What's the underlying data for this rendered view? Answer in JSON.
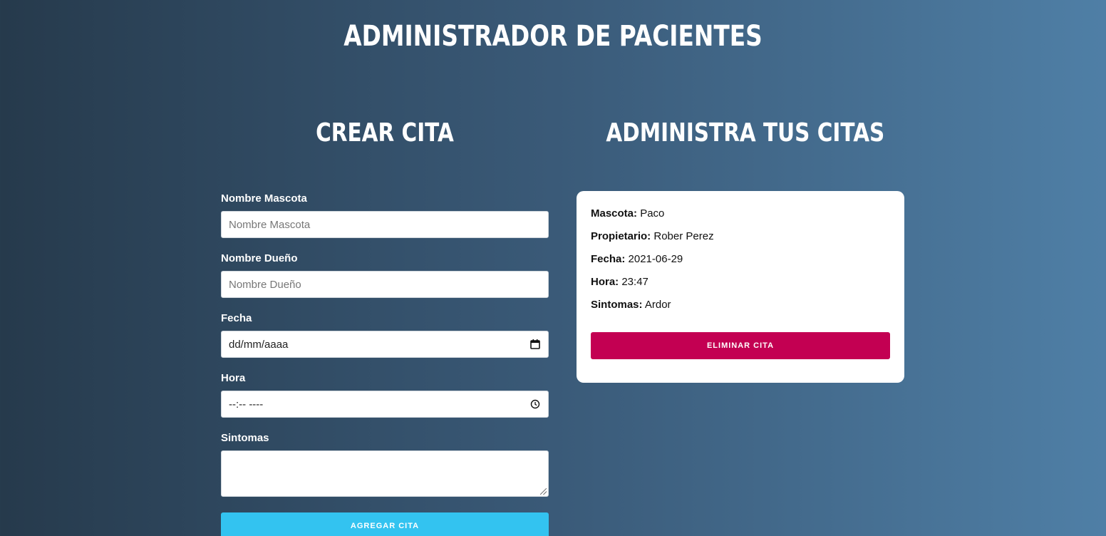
{
  "header": {
    "title": "ADMINISTRADOR DE PACIENTES"
  },
  "form": {
    "title": "CREAR CITA",
    "fields": [
      {
        "label": "Nombre Mascota",
        "placeholder": "Nombre Mascota"
      },
      {
        "label": "Nombre Dueño",
        "placeholder": "Nombre Dueño"
      },
      {
        "label": "Fecha",
        "value": "dd/mm/aaaa",
        "icon": "calendar-icon"
      },
      {
        "label": "Hora",
        "value": "--:-- ----",
        "icon": "clock-icon"
      },
      {
        "label": "Sintomas",
        "value": ""
      }
    ],
    "submit_label": "AGREGAR CITA"
  },
  "appointments": {
    "title": "ADMINISTRA TUS CITAS",
    "items": [
      {
        "pet_label": "Mascota:",
        "pet": "Paco",
        "owner_label": "Propietario:",
        "owner": "Rober Perez",
        "date_label": "Fecha:",
        "date": "2021-06-29",
        "time_label": "Hora:",
        "time": "23:47",
        "symptoms_label": "Sintomas:",
        "symptoms": "Ardor",
        "delete_label": "ELIMINAR CITA"
      }
    ]
  },
  "colors": {
    "add_button": "#33c3f0",
    "delete_button": "#c30052",
    "background_start": "#263a4c",
    "background_end": "#4f7fa6"
  }
}
